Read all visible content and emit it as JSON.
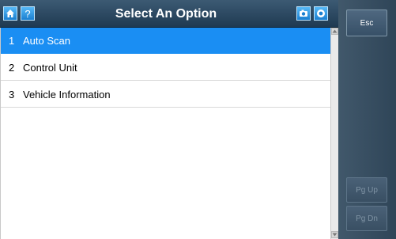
{
  "header": {
    "title": "Select An Option",
    "icons": [
      "home-icon",
      "help-icon",
      "camera-icon",
      "record-icon"
    ]
  },
  "list": {
    "items": [
      {
        "num": "1",
        "label": "Auto Scan",
        "selected": true
      },
      {
        "num": "2",
        "label": "Control Unit",
        "selected": false
      },
      {
        "num": "3",
        "label": "Vehicle Information",
        "selected": false
      }
    ]
  },
  "side": {
    "esc_label": "Esc",
    "pgup_label": "Pg Up",
    "pgdn_label": "Pg Dn"
  },
  "colors": {
    "accent": "#1a8ef3",
    "header": "#2b4a63",
    "side": "#3a5064"
  }
}
